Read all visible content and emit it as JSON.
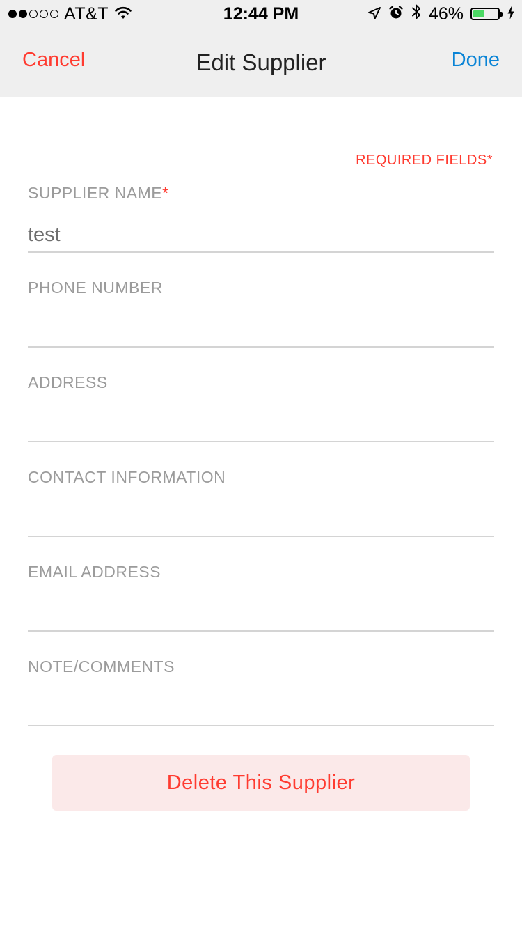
{
  "status_bar": {
    "carrier": "AT&T",
    "signal_bars_filled": 2,
    "signal_bars_total": 5,
    "time": "12:44 PM",
    "battery_percent": "46%",
    "battery_level": 0.46,
    "icons": [
      "wifi-icon",
      "location-arrow-icon",
      "alarm-icon",
      "bluetooth-icon",
      "battery-icon",
      "charging-bolt-icon"
    ]
  },
  "nav": {
    "cancel_label": "Cancel",
    "title": "Edit Supplier",
    "done_label": "Done"
  },
  "form": {
    "required_note": "REQUIRED FIELDS*",
    "fields": [
      {
        "label": "SUPPLIER NAME",
        "required": true,
        "value": "test"
      },
      {
        "label": "PHONE NUMBER",
        "required": false,
        "value": ""
      },
      {
        "label": "ADDRESS",
        "required": false,
        "value": ""
      },
      {
        "label": "CONTACT INFORMATION",
        "required": false,
        "value": ""
      },
      {
        "label": "EMAIL ADDRESS",
        "required": false,
        "value": ""
      },
      {
        "label": "NOTE/COMMENTS",
        "required": false,
        "value": ""
      }
    ],
    "required_marker": "*"
  },
  "delete_label": "Delete This Supplier",
  "colors": {
    "accent_red": "#ff3b30",
    "accent_blue": "#0a84d6",
    "nav_background": "#efefef",
    "label_gray": "#9b9b9b",
    "battery_green": "#4cd964",
    "delete_background": "#fbe9e9"
  }
}
